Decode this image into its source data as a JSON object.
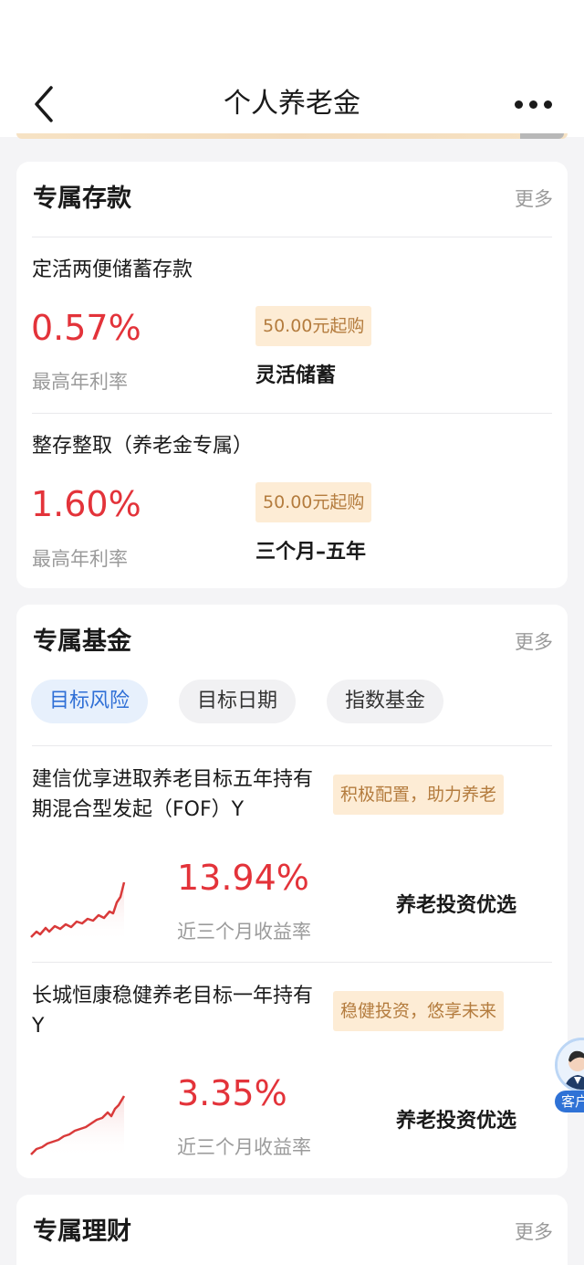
{
  "header": {
    "title": "个人养老金",
    "back_icon": "chevron-left-icon",
    "more_icon": "ellipsis-icon"
  },
  "deposits": {
    "title": "专属存款",
    "more": "更多",
    "items": [
      {
        "name": "定活两便储蓄存款",
        "rate": "0.57%",
        "rate_label": "最高年利率",
        "tag": "50.00元起购",
        "desc": "灵活储蓄"
      },
      {
        "name": "整存整取（养老金专属）",
        "rate": "1.60%",
        "rate_label": "最高年利率",
        "tag": "50.00元起购",
        "desc": "三个月–五年"
      }
    ]
  },
  "funds": {
    "title": "专属基金",
    "more": "更多",
    "tabs": [
      {
        "label": "目标风险",
        "active": true
      },
      {
        "label": "目标日期",
        "active": false
      },
      {
        "label": "指数基金",
        "active": false
      }
    ],
    "items": [
      {
        "name": "建信优享进取养老目标五年持有期混合型发起（FOF）Y",
        "tag": "积极配置，助力养老",
        "rate": "13.94%",
        "rate_label": "近三个月收益率",
        "desc": "养老投资优选"
      },
      {
        "name": "长城恒康稳健养老目标一年持有Y",
        "tag": "稳健投资，悠享未来",
        "rate": "3.35%",
        "rate_label": "近三个月收益率",
        "desc": "养老投资优选"
      }
    ]
  },
  "wealth": {
    "title": "专属理财",
    "more": "更多"
  },
  "service": {
    "label": "客户",
    "icon": "customer-service-icon"
  },
  "colors": {
    "accent_red": "#e3333a",
    "tag_bg": "#fdecd5",
    "tag_text": "#b47c3e",
    "active_tab": "#2f6fd6",
    "service_blue": "#2f72d6"
  }
}
